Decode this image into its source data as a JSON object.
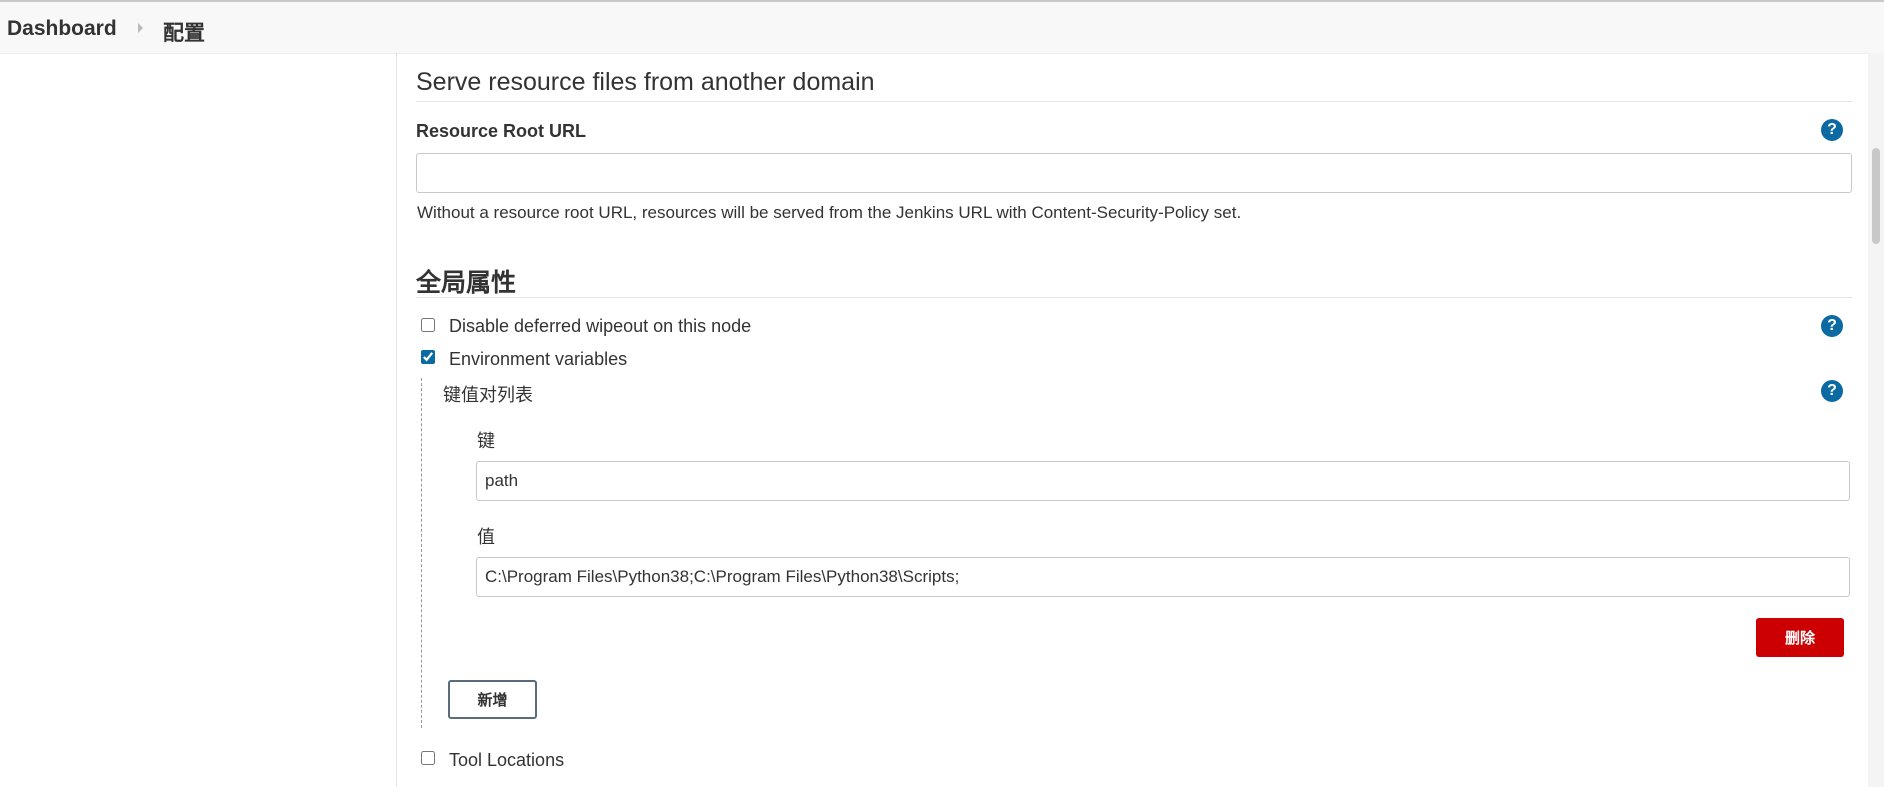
{
  "breadcrumb": {
    "dashboard": "Dashboard",
    "current": "配置"
  },
  "resource_section": {
    "title": "Serve resource files from another domain",
    "field_label": "Resource Root URL",
    "field_value": "",
    "description": "Without a resource root URL, resources will be served from the Jenkins URL with Content-Security-Policy set."
  },
  "global_properties": {
    "title": "全局属性",
    "disable_wipeout": {
      "label": "Disable deferred wipeout on this node",
      "checked": false
    },
    "env_vars": {
      "label": "Environment variables",
      "checked": true
    },
    "kv_list_label": "键值对列表",
    "key_label": "键",
    "key_value": "path",
    "value_label": "值",
    "value_value": "C:\\Program Files\\Python38;C:\\Program Files\\Python38\\Scripts;",
    "delete_button": "删除",
    "add_button": "新增",
    "tool_locations": {
      "label": "Tool Locations",
      "checked": false
    }
  },
  "help_icon_glyph": "?",
  "colors": {
    "help_icon": "#0b6aa2",
    "delete_button": "#cc0003",
    "breadcrumb_bg": "#f8f8f8"
  }
}
